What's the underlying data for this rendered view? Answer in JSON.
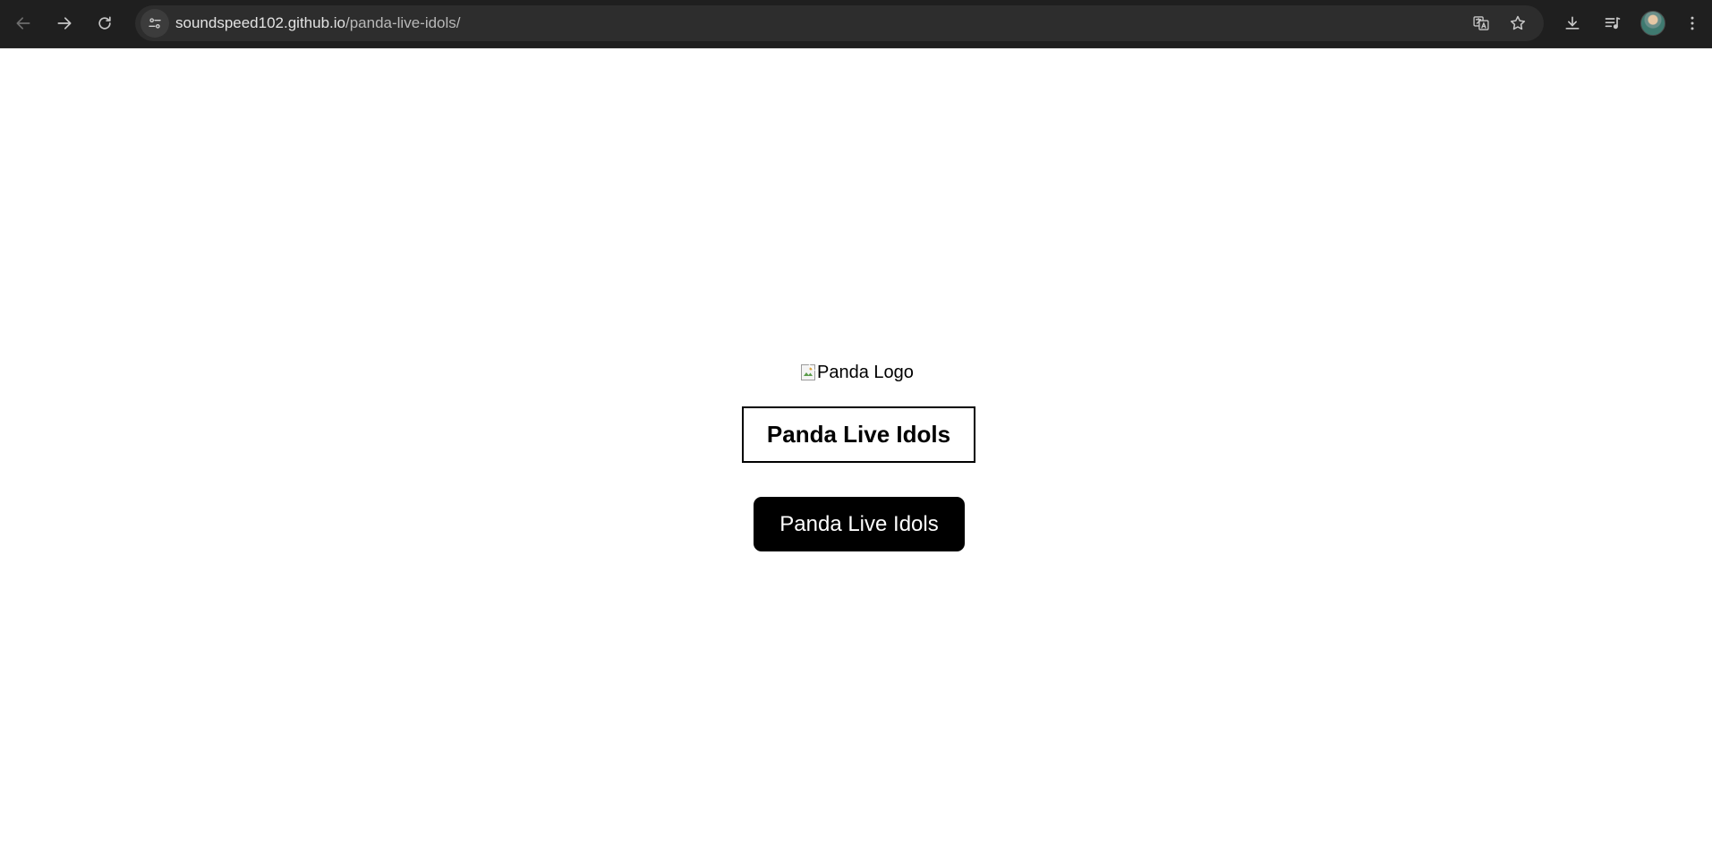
{
  "browser": {
    "url_host": "soundspeed102.github.io",
    "url_path": "/panda-live-idols/",
    "icons": {
      "back": "arrow-left-icon",
      "forward": "arrow-right-icon",
      "reload": "reload-icon",
      "site_info": "tune-icon",
      "translate": "translate-icon",
      "bookmark": "star-icon",
      "download": "download-icon",
      "media": "media-queue-icon",
      "profile": "avatar-icon",
      "menu": "more-vertical-icon"
    }
  },
  "page": {
    "logo_alt": "Panda Logo",
    "title": "Panda Live Idols",
    "button_label": "Panda Live Idols"
  },
  "colors": {
    "toolbar_bg": "#1f1f1f",
    "omnibox_bg": "#2d2d2d",
    "page_bg": "#ffffff",
    "button_bg": "#000000",
    "button_text": "#ffffff"
  }
}
